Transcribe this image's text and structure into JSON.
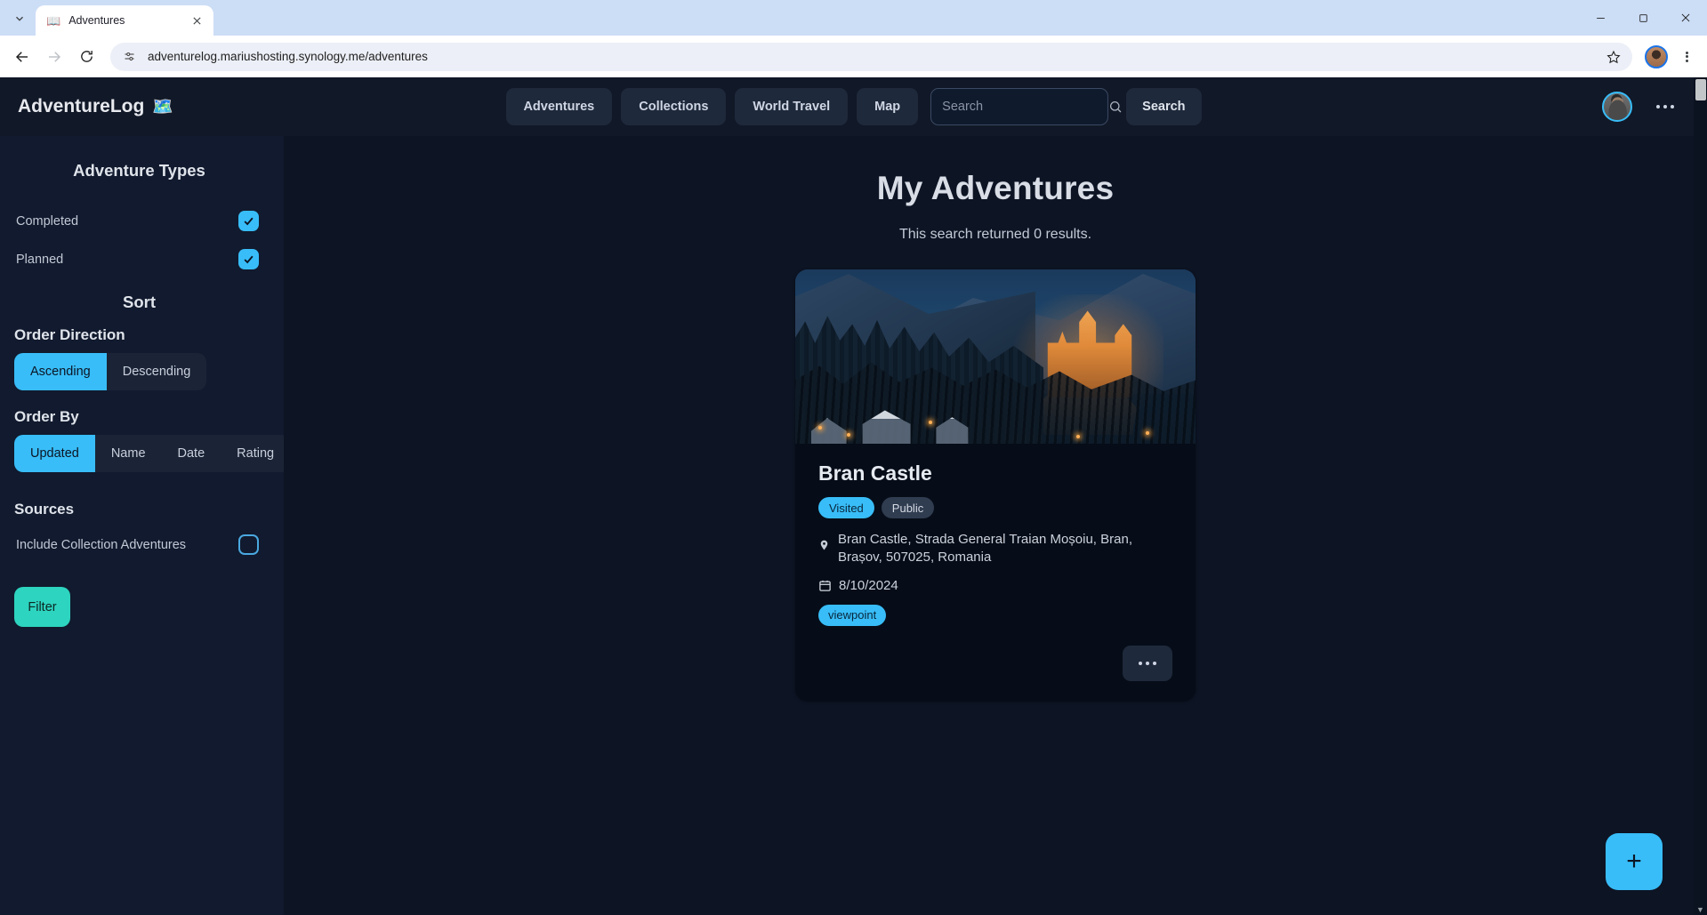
{
  "browser": {
    "tab": {
      "title": "Adventures",
      "favicon": "📖",
      "close_icon": "close-icon"
    },
    "tabstrip_dropdown_icon": "chevron-down-icon",
    "window_controls": {
      "minimize": "–",
      "maximize": "❐",
      "close": "✕"
    },
    "toolbar": {
      "back_icon": "back-arrow-icon",
      "forward_icon": "forward-arrow-icon",
      "reload_icon": "reload-icon",
      "site_info_icon": "site-settings-icon",
      "url": "adventurelog.mariushosting.synology.me/adventures",
      "bookmark_icon": "star-icon",
      "profile_icon": "profile-avatar-icon",
      "menu_icon": "three-dot-menu-icon"
    }
  },
  "navbar": {
    "brand": "AdventureLog",
    "brand_emoji": "🗺️",
    "links": [
      {
        "label": "Adventures"
      },
      {
        "label": "Collections"
      },
      {
        "label": "World Travel"
      },
      {
        "label": "Map"
      }
    ],
    "search": {
      "value": "",
      "placeholder": "Search",
      "icon": "search-icon"
    },
    "search_button": "Search",
    "avatar_alt": "user-avatar",
    "overflow_label": "•••"
  },
  "sidebar": {
    "adventure_types_heading": "Adventure Types",
    "types": [
      {
        "label": "Completed",
        "checked": true
      },
      {
        "label": "Planned",
        "checked": true
      }
    ],
    "sort_heading": "Sort",
    "order_direction_heading": "Order Direction",
    "order_direction": {
      "options": [
        "Ascending",
        "Descending"
      ],
      "selected": "Ascending"
    },
    "order_by_heading": "Order By",
    "order_by": {
      "options": [
        "Updated",
        "Name",
        "Date",
        "Rating"
      ],
      "selected": "Updated"
    },
    "sources_heading": "Sources",
    "sources": [
      {
        "label": "Include Collection Adventures",
        "checked": false
      }
    ],
    "filter_button": "Filter"
  },
  "main": {
    "title": "My Adventures",
    "subtitle": "This search returned 0 results.",
    "card": {
      "photo_alt": "bran-castle-winter-night-photo",
      "title": "Bran Castle",
      "badges": [
        {
          "label": "Visited",
          "style": "visited"
        },
        {
          "label": "Public",
          "style": "public"
        }
      ],
      "location_icon": "map-pin-icon",
      "location": "Bran Castle, Strada General Traian Moșoiu, Bran, Brașov, 507025, Romania",
      "date_icon": "calendar-icon",
      "date": "8/10/2024",
      "tags": [
        "viewpoint"
      ],
      "menu_label": "•••"
    },
    "fab_label": "+"
  },
  "colors": {
    "accent_blue": "#38bdf8",
    "accent_teal": "#2dd4bf",
    "page_bg": "#0d1424",
    "sidebar_bg": "#111a2e",
    "navbar_bg": "#111827",
    "card_bg": "#060d18"
  }
}
